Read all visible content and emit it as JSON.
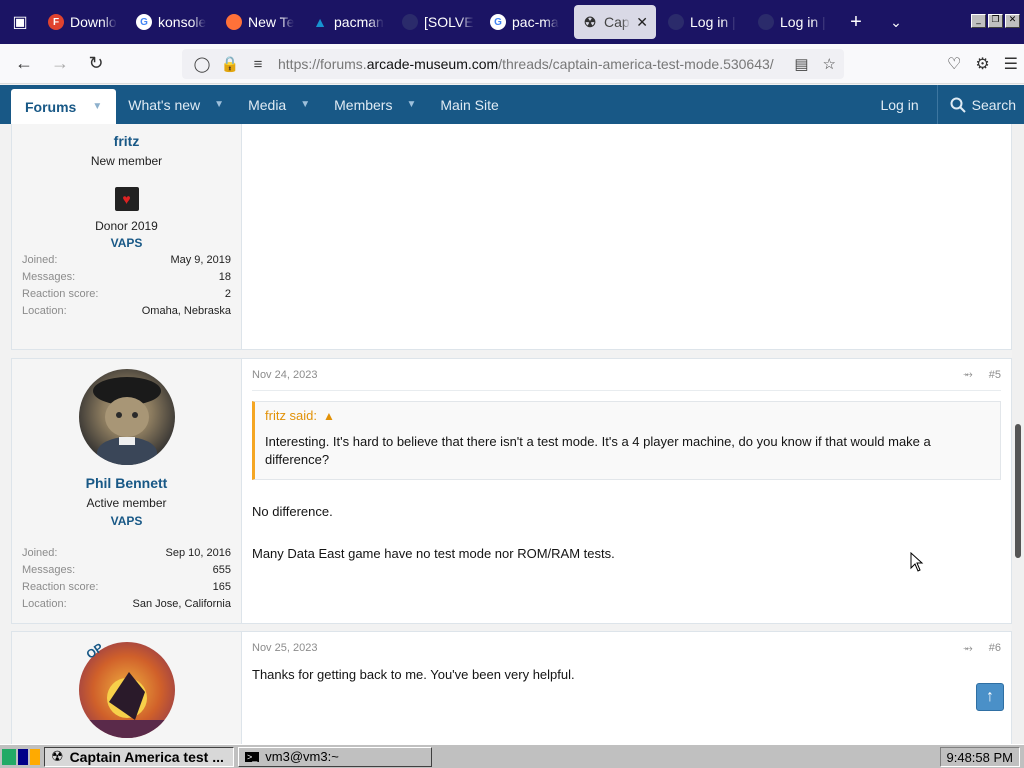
{
  "browser": {
    "tabs": [
      {
        "title": "Downlo",
        "icon": "download-icon",
        "color": "#e0432f"
      },
      {
        "title": "konsole",
        "icon": "google-icon",
        "color": "#ffffff"
      },
      {
        "title": "New Te",
        "icon": "firefox-icon",
        "color": "#ff7139"
      },
      {
        "title": "pacman",
        "icon": "arch-icon",
        "color": "#1793d1"
      },
      {
        "title": "[SOLVE",
        "icon": "forum-icon",
        "color": "#2b2b6b"
      },
      {
        "title": "pac-ma",
        "icon": "google-icon",
        "color": "#ffffff"
      },
      {
        "title": "Capt",
        "icon": "klov-icon",
        "color": "#333333",
        "active": true
      },
      {
        "title": "Log in |",
        "icon": "forum-icon",
        "color": "#2b2b6b"
      },
      {
        "title": "Log in |",
        "icon": "forum-icon",
        "color": "#2b2b6b"
      }
    ],
    "url_prefix": "https://forums.",
    "url_host": "arcade-museum.com",
    "url_path": "/threads/captain-america-test-mode.530643/"
  },
  "forum_nav": {
    "forums": "Forums",
    "whats_new": "What's new",
    "media": "Media",
    "members": "Members",
    "main_site": "Main Site",
    "login": "Log in",
    "search": "Search"
  },
  "post1": {
    "username": "fritz",
    "user_title": "New member",
    "badge": "Donor 2019",
    "banner": "VAPS",
    "stats": [
      {
        "k": "Joined:",
        "v": "May 9, 2019"
      },
      {
        "k": "Messages:",
        "v": "18"
      },
      {
        "k": "Reaction score:",
        "v": "2"
      },
      {
        "k": "Location:",
        "v": "Omaha, Nebraska"
      }
    ]
  },
  "post2": {
    "username": "Phil Bennett",
    "user_title": "Active member",
    "banner": "VAPS",
    "date": "Nov 24, 2023",
    "number": "#5",
    "quote_author": "fritz said:",
    "quote_text": "Interesting. It's hard to believe that there isn't a test mode. It's a 4 player machine, do you know if that would make a difference?",
    "para1": "No difference.",
    "para2": "Many Data East game have no test mode nor ROM/RAM tests.",
    "stats": [
      {
        "k": "Joined:",
        "v": "Sep 10, 2016"
      },
      {
        "k": "Messages:",
        "v": "655"
      },
      {
        "k": "Reaction score:",
        "v": "165"
      },
      {
        "k": "Location:",
        "v": "San Jose, California"
      }
    ]
  },
  "post3": {
    "op_badge": "OP",
    "date": "Nov 25, 2023",
    "number": "#6",
    "text": "Thanks for getting back to me. You've been very helpful."
  },
  "taskbar": {
    "task1": "Captain America test ...",
    "task2": "vm3@vm3:~",
    "clock": "9:48:58 PM"
  }
}
